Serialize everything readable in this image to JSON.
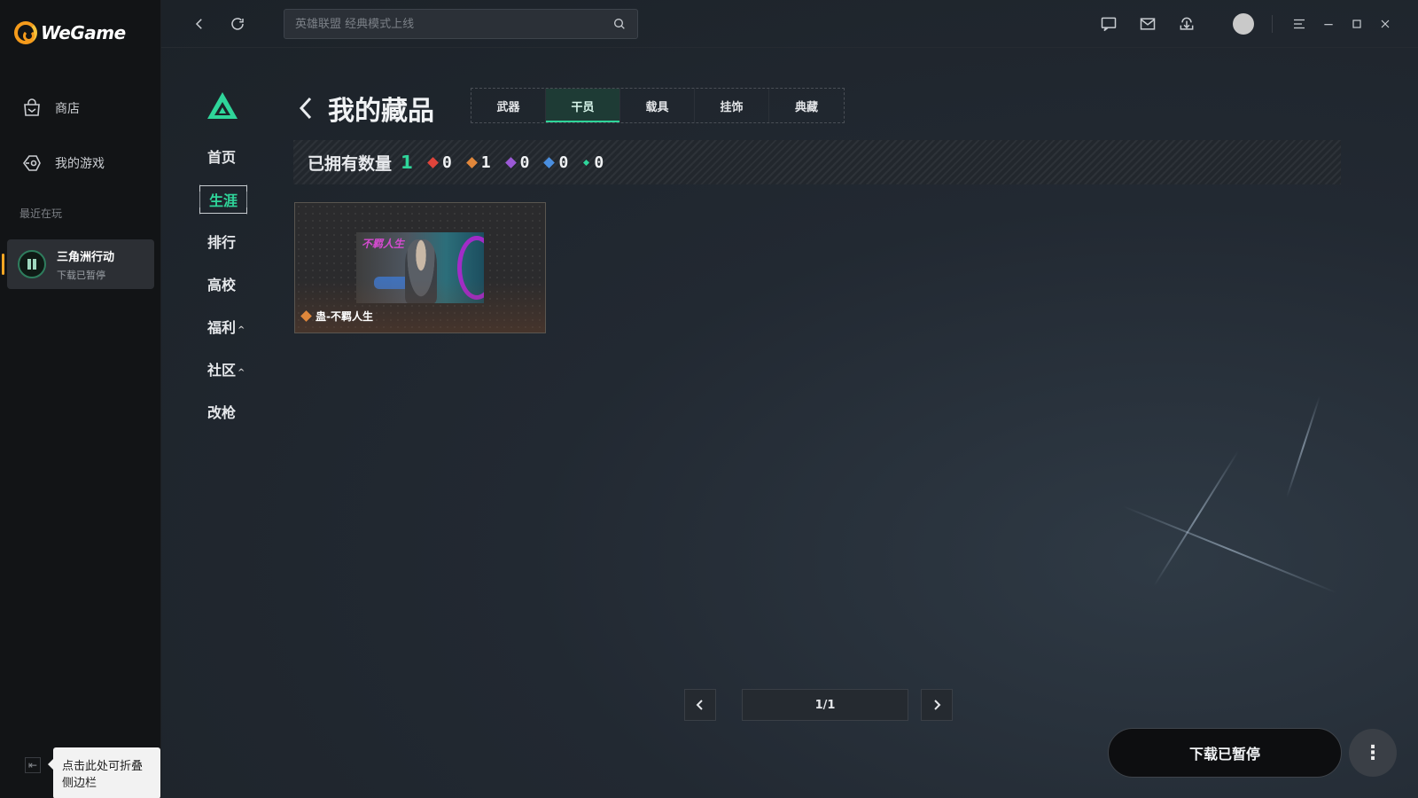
{
  "app": {
    "name": "WeGame"
  },
  "sidebar": {
    "items": [
      {
        "label": "商店",
        "icon": "store-bag-icon"
      },
      {
        "label": "我的游戏",
        "icon": "my-games-icon"
      }
    ],
    "recent_title": "最近在玩",
    "recent_game": {
      "name": "三角洲行动",
      "status": "下载已暂停"
    },
    "collapse_tooltip": "点击此处可折叠侧边栏"
  },
  "topbar": {
    "search_placeholder": "英雄联盟 经典模式上线",
    "icons": [
      "back-icon",
      "refresh-icon",
      "search-icon",
      "chat-icon",
      "mail-icon",
      "download-icon",
      "avatar",
      "menu-icon",
      "minimize-icon",
      "maximize-icon",
      "close-icon"
    ]
  },
  "game_nav": {
    "items": [
      {
        "label": "首页"
      },
      {
        "label": "生涯",
        "active": true
      },
      {
        "label": "排行"
      },
      {
        "label": "高校"
      },
      {
        "label": "福利",
        "caret": "^"
      },
      {
        "label": "社区",
        "caret": "^"
      },
      {
        "label": "改枪"
      }
    ]
  },
  "page": {
    "title": "我的藏品",
    "tabs": [
      {
        "label": "武器"
      },
      {
        "label": "干员",
        "active": true
      },
      {
        "label": "载具"
      },
      {
        "label": "挂饰"
      },
      {
        "label": "典藏"
      }
    ],
    "stats": {
      "label": "已拥有数量",
      "total": "1",
      "rarities": [
        {
          "color": "#e0443b",
          "value": "0"
        },
        {
          "color": "#e0873b",
          "value": "1"
        },
        {
          "color": "#9b59d6",
          "value": "0"
        },
        {
          "color": "#4a8fe0",
          "value": "0"
        },
        {
          "color": "#2fd59a",
          "value": "0"
        }
      ]
    },
    "items": [
      {
        "name": "蛊-不羁人生",
        "rarity_color": "#e0873b",
        "thumb_text": "不羁人生"
      }
    ],
    "pagination": {
      "display": "1/1"
    }
  },
  "footer": {
    "download_label": "下载已暂停",
    "more_label": "⋮"
  },
  "colors": {
    "accent": "#2fd59a",
    "brand": "#f59b1b",
    "bg": "#1b1f24"
  }
}
